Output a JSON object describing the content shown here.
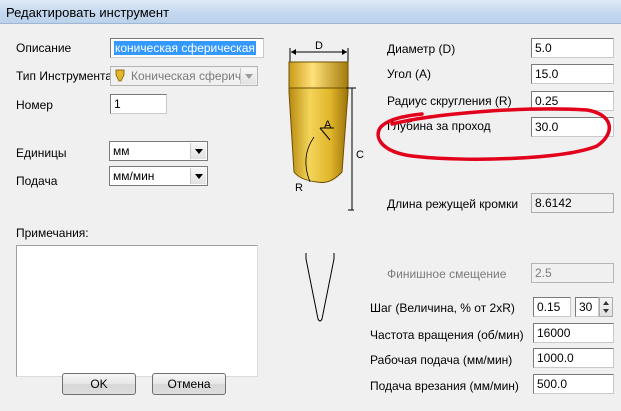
{
  "window": {
    "title": "Редактировать инструмент"
  },
  "left": {
    "description_label": "Описание",
    "description_value": "коническая сферическая",
    "tool_type_label": "Тип Инструмента",
    "tool_type_value": "Коническая сферичес",
    "tool_type_icon": "cone-tool-icon",
    "number_label": "Номер",
    "number_value": "1",
    "units_label": "Единицы",
    "units_value": "мм",
    "feed_label": "Подача",
    "feed_value": "мм/мин",
    "notes_label": "Примечания:",
    "notes_value": ""
  },
  "diagram": {
    "d": "D",
    "a": "A",
    "c": "C",
    "r": "R"
  },
  "right": {
    "diameter_label": "Диаметр (D)",
    "diameter_value": "5.0",
    "angle_label": "Угол (A)",
    "angle_value": "15.0",
    "radius_label": "Радиус скругления (R)",
    "radius_value": "0.25",
    "depth_label": "Глубина за проход",
    "depth_value": "30.0",
    "cut_length_label": "Длина режущей кромки",
    "cut_length_value": "8.6142",
    "finish_offset_label": "Финишное смещение",
    "finish_offset_value": "2.5",
    "step_label": "Шаг (Величина, % от 2xR)",
    "step_value": "0.15",
    "step_percent_value": "30",
    "spindle_label": "Частота вращения (об/мин)",
    "spindle_value": "16000",
    "work_feed_label": "Рабочая подача (мм/мин)",
    "work_feed_value": "1000.0",
    "plunge_feed_label": "Подача врезания (мм/мин)",
    "plunge_feed_value": "500.0"
  },
  "buttons": {
    "ok": "OK",
    "cancel": "Отмена"
  },
  "colors": {
    "titlebar": "#c4d8ef",
    "dialog_bg": "#f0f0f0",
    "tool_gold": "#e0b62a",
    "annotation_red": "#e3001b",
    "selection_blue": "#3399ff"
  }
}
